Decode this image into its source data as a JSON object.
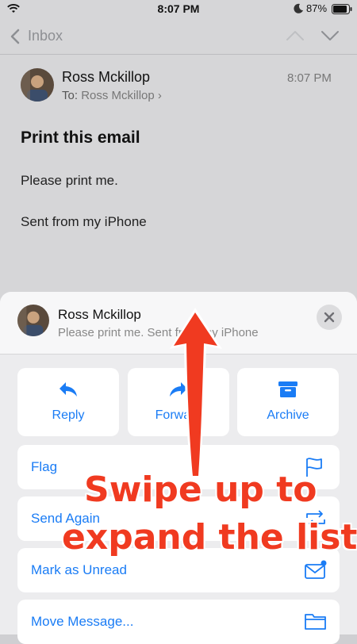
{
  "status_bar": {
    "time": "8:07 PM",
    "battery": "87%"
  },
  "nav": {
    "back_label": "Inbox"
  },
  "message": {
    "sender": "Ross Mckillop",
    "to_label": "To:",
    "to_name": "Ross Mckillop",
    "to_chevron": "›",
    "time": "8:07 PM",
    "subject": "Print this email",
    "body": [
      "Please print me.",
      "Sent from my iPhone"
    ]
  },
  "sheet": {
    "sender": "Ross Mckillop",
    "preview": "Please print me. Sent from my iPhone",
    "tiles": [
      {
        "label": "Reply",
        "icon": "reply-icon"
      },
      {
        "label": "Forward",
        "icon": "forward-icon"
      },
      {
        "label": "Archive",
        "icon": "archive-icon"
      }
    ],
    "rows": [
      {
        "label": "Flag",
        "icon": "flag-icon"
      },
      {
        "label": "Send Again",
        "icon": "send-again-icon"
      },
      {
        "label": "Mark as Unread",
        "icon": "mark-unread-icon"
      },
      {
        "label": "Move Message...",
        "icon": "folder-icon"
      }
    ]
  },
  "annotation": {
    "line1": "Swipe up to",
    "line2": "expand the list"
  },
  "colors": {
    "accent": "#1a7cf5",
    "annotation": "#f03a20",
    "dim_background": "#d6d6d8"
  }
}
